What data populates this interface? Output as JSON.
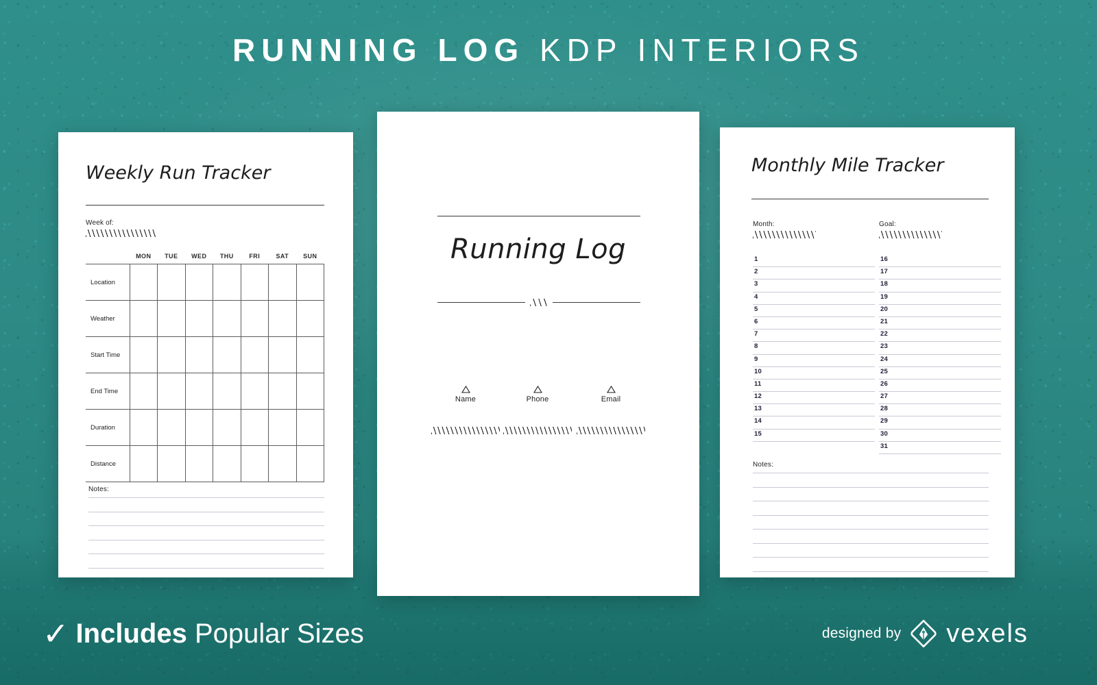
{
  "header": {
    "title_bold": "RUNNING LOG",
    "title_light": "KDP INTERIORS"
  },
  "theme": {
    "background_teal": "#2d8a85",
    "page_white": "#ffffff",
    "ink": "#1d1d1d",
    "rule_gray": "#5c5c5c",
    "ruled_line": "#c9c9d6"
  },
  "weekly_page": {
    "title": "Weekly Run Tracker",
    "week_of_label": "Week of:",
    "day_headers": [
      "MON",
      "TUE",
      "WED",
      "THU",
      "FRI",
      "SAT",
      "SUN"
    ],
    "row_labels": [
      "Location",
      "Weather",
      "Start Time",
      "End Time",
      "Duration",
      "Distance"
    ],
    "notes_label": "Notes:",
    "notes_line_count": 6
  },
  "cover_page": {
    "title": "Running Log",
    "contacts": [
      {
        "label": "Name"
      },
      {
        "label": "Phone"
      },
      {
        "label": "Email"
      }
    ]
  },
  "monthly_page": {
    "title": "Monthly Mile Tracker",
    "month_label": "Month:",
    "goal_label": "Goal:",
    "days_left": [
      "1",
      "2",
      "3",
      "4",
      "5",
      "6",
      "7",
      "8",
      "9",
      "10",
      "11",
      "12",
      "13",
      "14",
      "15"
    ],
    "days_right": [
      "16",
      "17",
      "18",
      "19",
      "20",
      "21",
      "22",
      "23",
      "24",
      "25",
      "26",
      "27",
      "28",
      "29",
      "30",
      "31"
    ],
    "notes_label": "Notes:",
    "notes_line_count": 8
  },
  "footer": {
    "check_glyph": "✓",
    "includes_bold": "Includes",
    "includes_light": "Popular Sizes",
    "designed_by": "designed by",
    "brand": "vexels"
  }
}
